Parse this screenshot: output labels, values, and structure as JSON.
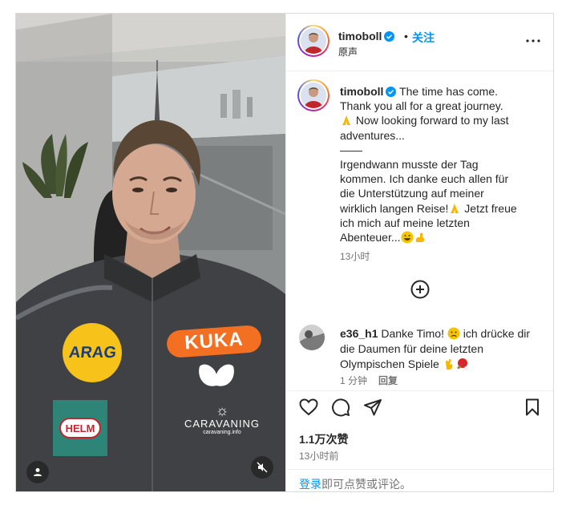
{
  "post": {
    "username": "timoboll",
    "header_dot": "•",
    "follow_label": "关注",
    "audio_label": "原声",
    "caption": {
      "line1": "The time has come.",
      "line2": "Thank you all for a great journey.",
      "line3_after_emoji": " Now looking forward to my last",
      "line4": "adventures...",
      "divider": "——",
      "de_line1": "Irgendwann musste der Tag",
      "de_line2": "kommen. Ich danke euch allen für",
      "de_line3": "die Unterstützung auf meiner",
      "de_line4_before_emoji": "wirklich langen Reise!",
      "de_line4_after_emoji": " Jetzt freue",
      "de_line5": "ich mich auf meine letzten",
      "de_line6": "Abenteuer..."
    },
    "caption_time": "13小时",
    "comment": {
      "username": "e36_h1",
      "text1": " Danke Timo! ",
      "text1b": " ich drücke dir",
      "text2": "die Daumen für deine letzten",
      "text3": "Olympischen Spiele ",
      "time": "1 分钟",
      "reply_label": "回复"
    },
    "likes": "1.1万次赞",
    "post_time": "13小时前",
    "login_link": "登录",
    "login_rest": "即可点赞或评论。"
  },
  "jersey": {
    "sponsor_left": "ARAG",
    "sponsor_right": "KUKA",
    "sponsor_bottom_left": "HELM",
    "sponsor_bottom_right": "CARAVANING",
    "sponsor_bottom_right_sub": "caravaning.info"
  },
  "icons": {
    "verified": "verified-badge-icon",
    "more": "more-horizontal-icon",
    "add_comment": "plus-circle-icon",
    "like": "heart-icon",
    "comment": "comment-bubble-icon",
    "share": "paper-plane-icon",
    "save": "bookmark-icon",
    "user_tag": "user-icon",
    "mute": "speaker-muted-icon"
  },
  "colors": {
    "link_blue": "#0095f6",
    "verified_blue": "#0095f6",
    "muted_text": "#737373",
    "border": "#dbdbdb"
  }
}
